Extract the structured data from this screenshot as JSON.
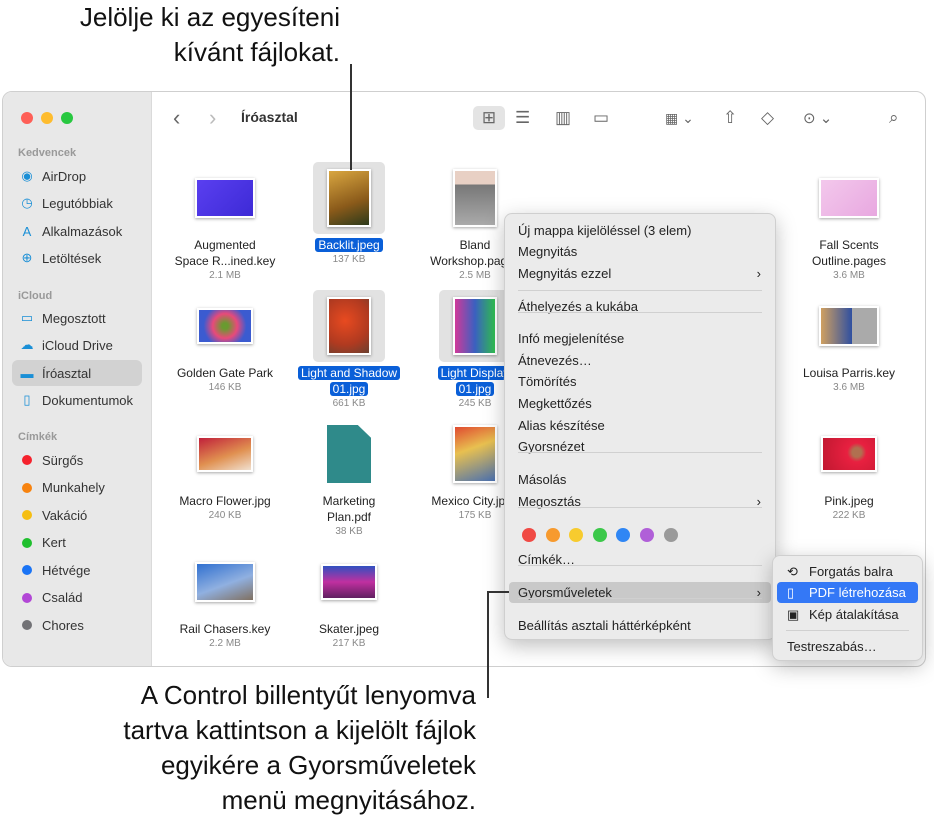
{
  "callouts": {
    "top": [
      "Jelölje ki az egyesíteni",
      "kívánt fájlokat."
    ],
    "bottom": [
      "A Control billentyűt lenyomva",
      "tartva kattintson a kijelölt fájlok",
      "egyikére a Gyorsműveletek",
      "menü megnyitásához."
    ]
  },
  "window": {
    "title": "Íróasztal"
  },
  "toolbar": {
    "icons": [
      "back-icon",
      "forward-icon",
      "icon-view-icon",
      "list-view-icon",
      "column-view-icon",
      "gallery-view-icon",
      "group-icon",
      "share-icon",
      "tag-icon",
      "more-icon",
      "search-icon"
    ],
    "active_view": "icon-view"
  },
  "sidebar": {
    "sections": [
      {
        "title": "Kedvencek",
        "items": [
          {
            "label": "AirDrop",
            "icon": "airdrop-icon"
          },
          {
            "label": "Legutóbbiak",
            "icon": "clock-icon"
          },
          {
            "label": "Alkalmazások",
            "icon": "apps-icon"
          },
          {
            "label": "Letöltések",
            "icon": "download-icon"
          }
        ]
      },
      {
        "title": "iCloud",
        "items": [
          {
            "label": "Megosztott",
            "icon": "shared-folder-icon"
          },
          {
            "label": "iCloud Drive",
            "icon": "cloud-icon"
          },
          {
            "label": "Íróasztal",
            "icon": "desktop-icon",
            "selected": true
          },
          {
            "label": "Dokumentumok",
            "icon": "document-icon"
          }
        ]
      },
      {
        "title": "Címkék",
        "items": [
          {
            "label": "Sürgős",
            "color": "#f5222d"
          },
          {
            "label": "Munkahely",
            "color": "#f7830f"
          },
          {
            "label": "Vakáció",
            "color": "#f5be12"
          },
          {
            "label": "Kert",
            "color": "#1fbf2e"
          },
          {
            "label": "Hétvége",
            "color": "#1a74f5"
          },
          {
            "label": "Család",
            "color": "#b247d6"
          },
          {
            "label": "Chores",
            "color": "#727276"
          }
        ]
      }
    ]
  },
  "files": [
    {
      "name": "Augmented Space R...ined.key",
      "size": "2.1 MB"
    },
    {
      "name": "Backlit.jpeg",
      "size": "137 KB",
      "selected": true
    },
    {
      "name": "Bland Workshop.pages",
      "size": "2.5 MB"
    },
    {
      "name": "Fall Scents Outline.pages",
      "size": "3.6 MB"
    },
    {
      "name": "Golden Gate Park",
      "size": "146 KB"
    },
    {
      "name": "Light and Shadow 01.jpg",
      "size": "661 KB",
      "selected": true
    },
    {
      "name": "Light Display 01.jpg",
      "size": "245 KB",
      "selected": true
    },
    {
      "name": "Louisa Parris.key",
      "size": "3.6 MB"
    },
    {
      "name": "Macro Flower.jpg",
      "size": "240 KB"
    },
    {
      "name": "Marketing Plan.pdf",
      "size": "38 KB"
    },
    {
      "name": "Mexico City.jpeg",
      "size": "175 KB"
    },
    {
      "name": "Pink.jpeg",
      "size": "222 KB"
    },
    {
      "name": "Rail Chasers.key",
      "size": "2.2 MB"
    },
    {
      "name": "Skater.jpeg",
      "size": "217 KB"
    }
  ],
  "context_menu": {
    "items": [
      "Új mappa kijelöléssel (3 elem)",
      "Megnyitás",
      "Megnyitás ezzel",
      "Áthelyezés a kukába",
      "Infó megjelenítése",
      "Átnevezés…",
      "Tömörítés",
      "Megkettőzés",
      "Alias készítése",
      "Gyorsnézet",
      "Másolás",
      "Megosztás",
      "Címkék…",
      "Gyorsműveletek",
      "Beállítás asztali háttérképként"
    ],
    "tag_colors": [
      "#f04a44",
      "#f79a2e",
      "#f7cb2e",
      "#3cc84a",
      "#2f86f4",
      "#b05fd8",
      "#9a9a9a"
    ],
    "highlighted": "Gyorsműveletek"
  },
  "submenu": {
    "items": [
      "Forgatás balra",
      "PDF létrehozása",
      "Kép átalakítása",
      "Testreszabás…"
    ],
    "highlighted": "PDF létrehozása"
  }
}
